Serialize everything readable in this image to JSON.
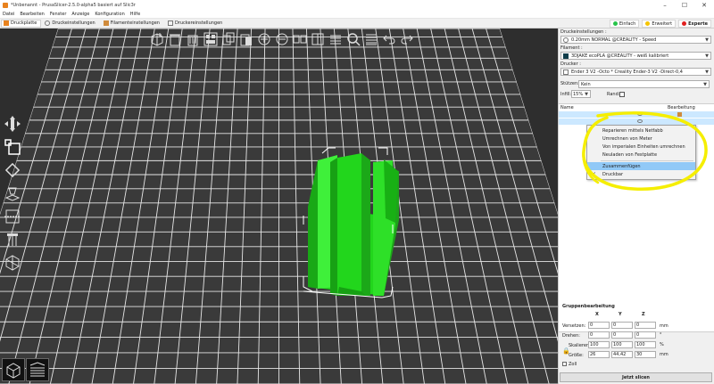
{
  "window": {
    "title": "*Unbenannt - PrusaSlicer-2.5.0-alpha5 basiert auf Slic3r",
    "minimize": "–",
    "maximize": "☐",
    "close": "✕"
  },
  "menu": [
    "Datei",
    "Bearbeiten",
    "Fenster",
    "Anzeige",
    "Konfiguration",
    "Hilfe"
  ],
  "tabs": [
    {
      "label": "Druckplatte",
      "active": true
    },
    {
      "label": "Druckeinstellungen",
      "active": false
    },
    {
      "label": "Filamenteinstellungen",
      "active": false
    },
    {
      "label": "Druckereinstellungen",
      "active": false
    }
  ],
  "modes": [
    {
      "label": "Einfach",
      "color": "#27c44a"
    },
    {
      "label": "Erweitert",
      "color": "#f5c400"
    },
    {
      "label": "Experte",
      "color": "#e02020"
    }
  ],
  "right": {
    "print_label": "Druckeinstellungen :",
    "print_value": "0.20mm NORMAL @CREALITY - Speed",
    "filament_label": "Filament :",
    "filament_value": "3DJAKE ecoPLA @CREALITY - weiß kalibriert",
    "printer_label": "Drucker :",
    "printer_value": "Ender 3 V2 -Octo * Creality Ender-3 V2 -Direct-0,4",
    "supports_label": "Stützen:",
    "supports_value": "Kein",
    "infill_label": "Infill:",
    "infill_value": "15%",
    "brim_label": "Rand:",
    "list_col_name": "Name",
    "list_col_edit": "Bearbeitung"
  },
  "context_menu": [
    {
      "label": "Reparieren mittels Netfabb",
      "highlight": false,
      "checked": false
    },
    {
      "label": "Umrechnen von Meter",
      "highlight": false,
      "checked": false
    },
    {
      "label": "Von imperialen Einheiten umrechnen",
      "highlight": false,
      "checked": false
    },
    {
      "label": "Neuladen von Festplatte",
      "highlight": false,
      "checked": false
    },
    {
      "label": "Zusammenfügen",
      "highlight": true,
      "checked": false
    },
    {
      "label": "Druckbar",
      "highlight": false,
      "checked": true
    }
  ],
  "group_edit": {
    "title": "Gruppenbearbeitung",
    "col_x": "X",
    "col_y": "Y",
    "col_z": "Z",
    "move_label": "Versetzen:",
    "move": [
      "0",
      "0",
      "0"
    ],
    "move_unit": "mm",
    "rotate_label": "Drehen:",
    "rotate": [
      "0",
      "0",
      "0"
    ],
    "rotate_unit": "°",
    "scale_label": "Skalieren:",
    "scale": [
      "100",
      "100",
      "100"
    ],
    "scale_unit": "%",
    "size_label": "Größe:",
    "size": [
      "26",
      "44,42",
      "30"
    ],
    "size_unit": "mm",
    "inch_label": "Zoll"
  },
  "slice_button": "Jetzt slicen",
  "colors": {
    "object": "#22d61c",
    "grid": "#e6e6e6",
    "viewport": "#2e2e2e",
    "annotation": "#f5ee00",
    "selection": "#cce8ff"
  }
}
